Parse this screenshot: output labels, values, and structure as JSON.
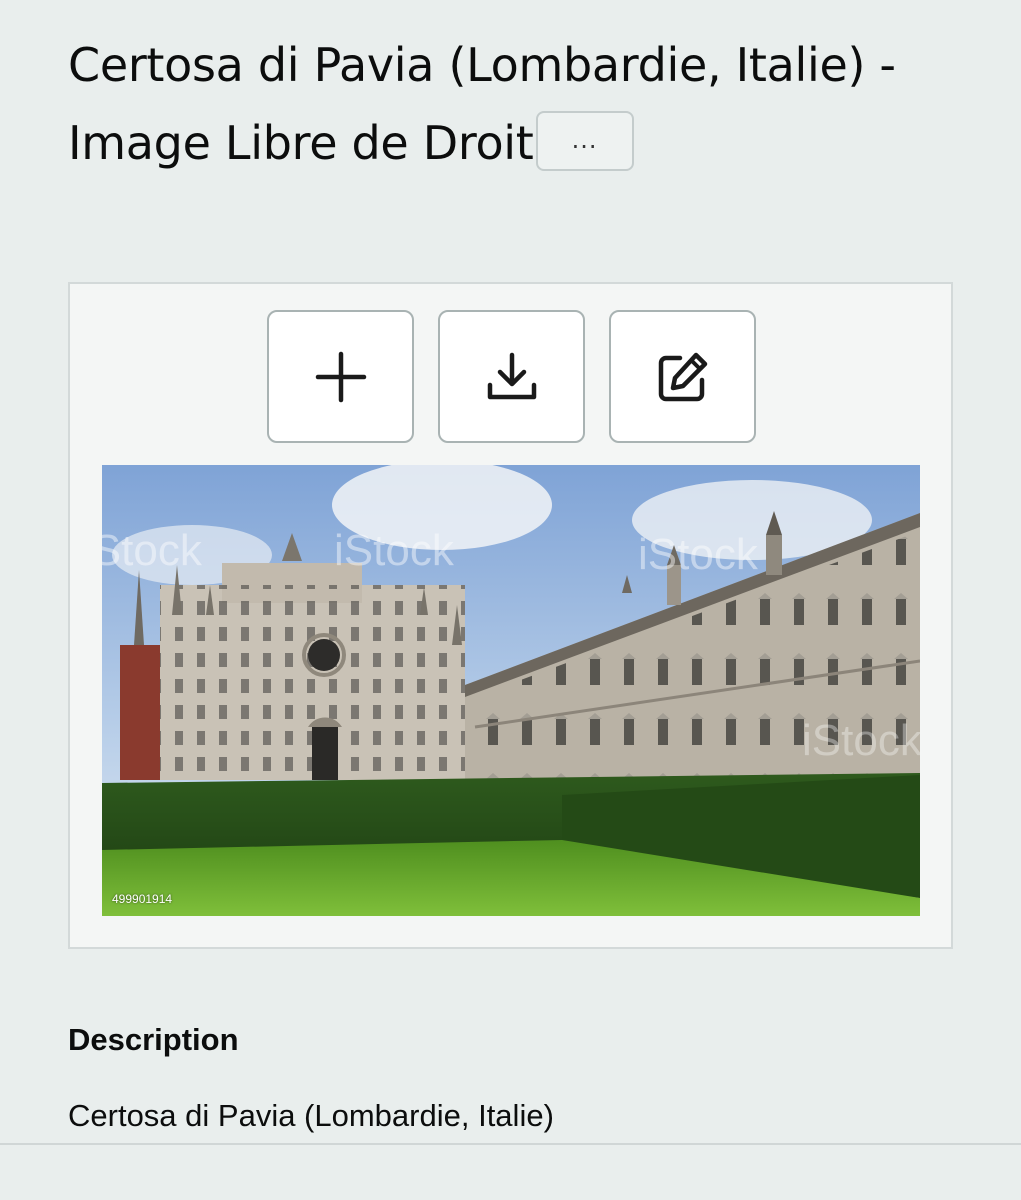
{
  "header": {
    "title": "Certosa di Pavia (Lombardie, Italie) - Image Libre de Droit",
    "more_label": "..."
  },
  "actions": [
    {
      "name": "add",
      "icon": "plus-icon"
    },
    {
      "name": "download",
      "icon": "download-icon"
    },
    {
      "name": "edit",
      "icon": "edit-icon"
    }
  ],
  "image": {
    "id_label": "499901914",
    "watermark": "iStock",
    "subject": "Certosa di Pavia"
  },
  "description": {
    "heading": "Description",
    "text": "Certosa di Pavia (Lombardie, Italie)"
  },
  "colors": {
    "background": "#e9eeed",
    "card_border": "#d3d9d9",
    "button_border": "#a9b3b3"
  }
}
